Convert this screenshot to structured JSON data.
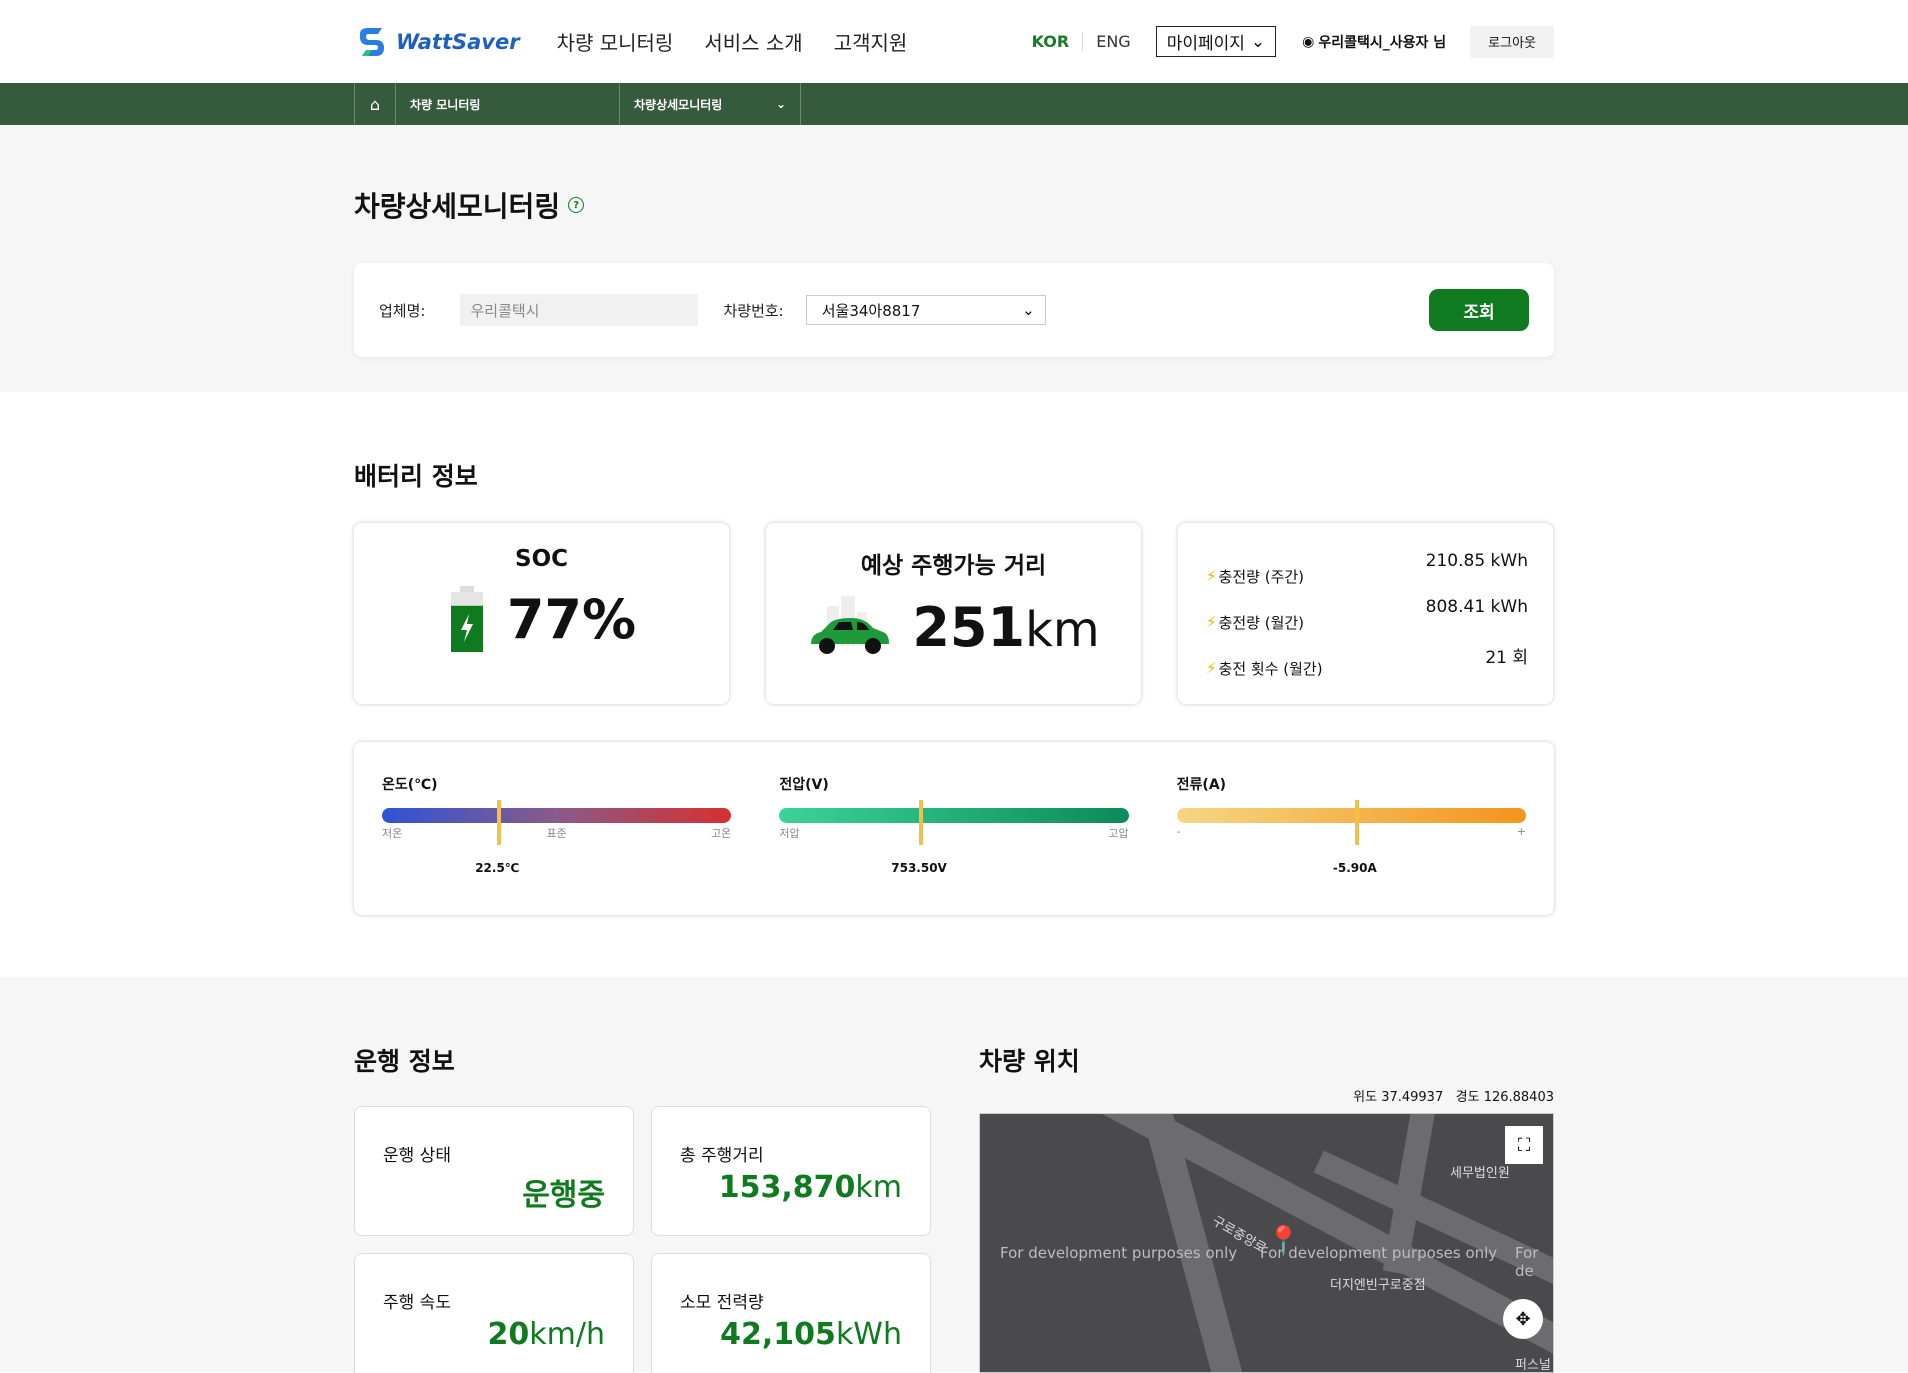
{
  "header": {
    "logo_text": "WattSaver",
    "nav": [
      "차량 모니터링",
      "서비스 소개",
      "고객지원"
    ],
    "lang_kor": "KOR",
    "lang_eng": "ENG",
    "mypage": "마이페이지",
    "user": "우리콜택시_사용자 님",
    "logout": "로그아웃"
  },
  "breadcrumb": {
    "item1": "차량 모니터링",
    "item2": "차량상세모니터링"
  },
  "page_title": "차량상세모니터링",
  "search": {
    "company_label": "업체명:",
    "company_value": "우리콜택시",
    "vehicle_label": "차량번호:",
    "vehicle_value": "서울34아8817",
    "button": "조회"
  },
  "battery": {
    "title": "배터리 정보",
    "soc_title": "SOC",
    "soc_value": "77%",
    "soc_level": 77,
    "range_title": "예상 주행가능 거리",
    "range_value": "251",
    "range_unit": "km",
    "stats": [
      {
        "label": "충전량 (주간)",
        "value": "210.85 kWh"
      },
      {
        "label": "충전량 (월간)",
        "value": "808.41 kWh"
      },
      {
        "label": "충전 횟수 (월간)",
        "value": "21 회"
      }
    ],
    "gauges": {
      "temp": {
        "title": "온도(℃)",
        "ticks": [
          "저온",
          "표준",
          "고온"
        ],
        "value": "22.5℃",
        "position": 0.33
      },
      "volt": {
        "title": "전압(V)",
        "ticks": [
          "저압",
          "고압"
        ],
        "value": "753.50V",
        "position": 0.4
      },
      "curr": {
        "title": "전류(A)",
        "ticks": [
          "-",
          "+"
        ],
        "value": "-5.90A",
        "position": 0.51
      }
    }
  },
  "drive": {
    "title": "운행 정보",
    "tiles": [
      {
        "label": "운행 상태",
        "value": "운행중",
        "unit": ""
      },
      {
        "label": "총 주행거리",
        "value": "153,870",
        "unit": "km"
      },
      {
        "label": "주행 속도",
        "value": "20",
        "unit": "km/h"
      },
      {
        "label": "소모 전력량",
        "value": "42,105",
        "unit": "kWh"
      }
    ]
  },
  "location": {
    "title": "차량 위치",
    "lat_label": "위도",
    "lat": "37.49937",
    "lng_label": "경도",
    "lng": "126.88403",
    "dev_text": "For development purposes only",
    "dev_text_short": "For de",
    "labels": [
      "세무법인원",
      "더지엔빈구로중점",
      "구로중앙로",
      "퍼스널"
    ]
  },
  "colors": {
    "accent": "#0f7a1f",
    "breadcrumb_bg": "#355a3c"
  }
}
